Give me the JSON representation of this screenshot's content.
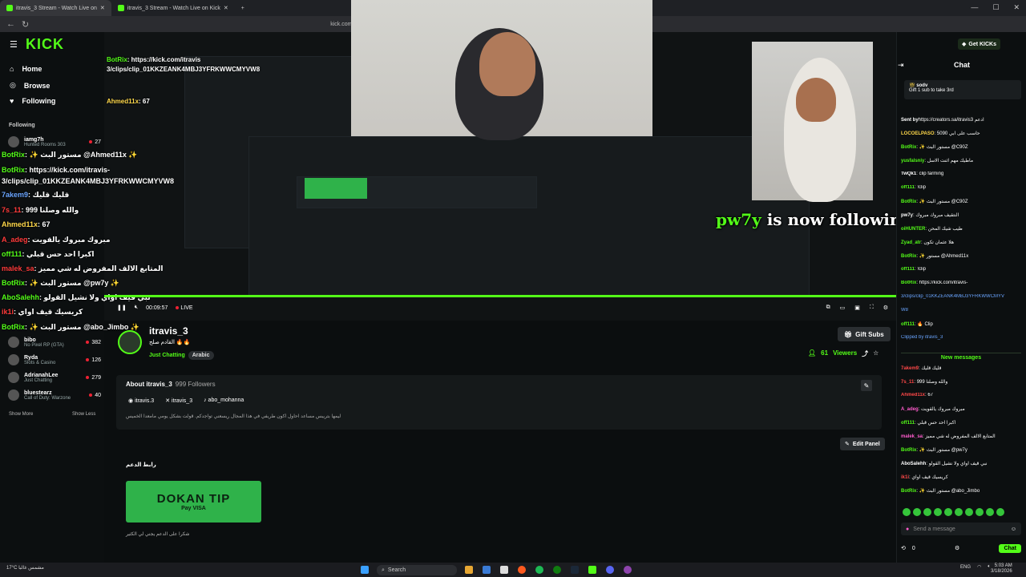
{
  "browser": {
    "tabs": [
      {
        "label": "itravis_3 Stream - Watch Live on"
      },
      {
        "label": "itravis_3 Stream - Watch Live on Kick"
      }
    ],
    "url": "kick.com/itravis"
  },
  "sidebar": {
    "logo": "KICK",
    "nav": [
      {
        "label": "Home"
      },
      {
        "label": "Browse"
      },
      {
        "label": "Following"
      }
    ],
    "following_heading": "Following",
    "following": [
      {
        "name": "iamg7h",
        "game": "Hunted Rooms 303",
        "viewers": "27"
      },
      {
        "name": "bibo",
        "game": "No Pixel RP (GTA)",
        "viewers": "382"
      },
      {
        "name": "Ryda",
        "game": "Slots & Casino",
        "viewers": "126"
      },
      {
        "name": "AdrianahLee",
        "game": "Just Chatting",
        "viewers": "279"
      },
      {
        "name": "bluestearz",
        "game": "Call of Duty: Warzone",
        "viewers": "40"
      }
    ],
    "show_more": "Show More",
    "show_less": "Show Less"
  },
  "overlay_chat": [
    {
      "user": "BotRix",
      "text": ": https://kick.com/itravis"
    },
    {
      "user": "",
      "text": "3/clips/clip_01KKZEANK4MBJ3YFRKWWCMYVW8"
    },
    {
      "user": "Ahmed11x",
      "text": ": 67"
    },
    {
      "user": "BotRix",
      "text": ": ✨ مستور البث @Ahmed11x ✨"
    },
    {
      "user": "BotRix",
      "text": ": https://kick.com/itravis-"
    },
    {
      "user": "",
      "text": "3/clips/clip_01KKZEANK4MBJ3YFRKWWCMYVW8"
    },
    {
      "user": "7akem9",
      "text": ": قليك قليك"
    },
    {
      "user": "7s_11",
      "text": ": 999 والله وصلنا"
    },
    {
      "user": "Ahmed11x",
      "text": ": 67"
    },
    {
      "user": "A_adeg",
      "text": ": مبروك مبروك يالقويت"
    },
    {
      "user": "off111",
      "text": ": اكبرا احد حس قبلي"
    },
    {
      "user": "malek_sa",
      "text": ": المتابع الالف المفروض له شي مميز"
    },
    {
      "user": "BotRix",
      "text": ": ✨ مستور البث @pw7y ✨"
    },
    {
      "user": "AboSalehh",
      "text": ": نبي قيف اواي ولا نشيل القولو"
    },
    {
      "user": "ik1i",
      "text": ": كريسيك قيف اواي"
    },
    {
      "user": "BotRix",
      "text": ": ✨ مستور البث @abo_Jimbo ✨"
    }
  ],
  "stream": {
    "follow_alert_user": "pw7y",
    "follow_alert_text": " is now following!",
    "time": "00:09:57",
    "live": "LIVE"
  },
  "channel": {
    "name": "itravis_3",
    "title": "القادم صلح 🔥🔥",
    "category": "Just Chatting",
    "tag": "Arabic",
    "gift_subs": "Gift Subs",
    "viewers": "61",
    "viewers_label": "Viewers",
    "about_title": "About itravis_3",
    "followers": "999 Followers",
    "socials": [
      {
        "icon": "instagram-icon",
        "label": "itravis.3"
      },
      {
        "icon": "x-icon",
        "label": "itravis_3"
      },
      {
        "icon": "tiktok-icon",
        "label": "abo_mohanna"
      }
    ],
    "bio": "ليمها بتريبس مساعد احاول اكون طريفي في هذا المجال ريسعني تواجدكم. قولت بشكل يومي مامعدا الخميس",
    "edit_panel": "Edit Panel",
    "donate_label": "رابط الدعم",
    "dokan_title": "DOKAN TIP",
    "dokan_pay": "Pay VISA",
    "thanks": "شكرا على الدعم يجني لي الكثير"
  },
  "chat": {
    "get_kicks": "Get KICKs",
    "title": "Chat",
    "pinned_user": "sodv",
    "pinned_text": "Gift 1 sub to take 3rd",
    "messages": [
      {
        "user": "Sent by",
        "text": "https://creators.sa/itravis3 ادعم ",
        "c": "wh"
      },
      {
        "user": "LOCOELPASO",
        "text": ": حاسب على ابي 5090",
        "c": "yl"
      },
      {
        "user": "BotRix",
        "text": ": ✨ مستور البث @C90Z",
        "c": "g"
      },
      {
        "user": "yusfalsniy",
        "text": ": ماطيك مهم اثنت الاسل",
        "c": "g"
      },
      {
        "user": "TwQk1",
        "text": ": clip farming",
        "c": "wh"
      },
      {
        "user": "off111",
        "text": ": !clip",
        "c": "g"
      },
      {
        "user": "BotRix",
        "text": ": ✨ مستور البث @C90Z",
        "c": "g"
      },
      {
        "user": "pw7y",
        "text": ": النتقيف مبروك مبروك",
        "c": "wh"
      },
      {
        "user": "oiHUNTER",
        "text": ": طيب شيك المحن",
        "c": "g"
      },
      {
        "user": "Zyad_atr",
        "text": ": هلا عثمان تكون",
        "c": "g"
      },
      {
        "user": "BotRix",
        "text": ": ✨ مستور @Ahmed11x",
        "c": "g"
      },
      {
        "user": "off111",
        "text": ": !clip",
        "c": "g"
      },
      {
        "user": "BotRix",
        "text": ": https://kick.com/itravis-",
        "c": "g"
      },
      {
        "user": "",
        "text": "3/clips/clip_01KKZEANK4MBJ3YFRKWWCMYV",
        "c": "bl"
      },
      {
        "user": "",
        "text": "W8",
        "c": "bl"
      },
      {
        "user": "off111",
        "text": ": 🔥 Clip",
        "c": "g"
      },
      {
        "user": "",
        "text": "Clipped by itravis_3",
        "c": "wh"
      }
    ],
    "new_messages": "New messages",
    "messages2": [
      {
        "user": "7akem9",
        "text": ": قليك قليك",
        "c": "rd"
      },
      {
        "user": "7s_11",
        "text": ": 999 والله وصلنا",
        "c": "rd"
      },
      {
        "user": "Ahmed11x",
        "text": ": 67",
        "c": "rd"
      },
      {
        "user": "A_adeg",
        "text": ": مبروك مبروك يالقويت",
        "c": "pk"
      },
      {
        "user": "off111",
        "text": ": اكبرا احد حس قبلي",
        "c": "g"
      },
      {
        "user": "malek_sa",
        "text": ": المتابع الالف المفروض له شي مميز",
        "c": "pk"
      },
      {
        "user": "BotRix",
        "text": ": ✨ مستور البث @pw7y",
        "c": "g"
      },
      {
        "user": "AboSalehh",
        "text": ": نبي قيف اواي ولا نشيل القولو",
        "c": "wh"
      },
      {
        "user": "ik1i",
        "text": ": كريسيك قيف اواي",
        "c": "rd"
      },
      {
        "user": "BotRix",
        "text": ": ✨ مستور البث @abo_Jimbo",
        "c": "g"
      }
    ],
    "input_placeholder": "Send a message",
    "points": "0",
    "chat_button": "Chat"
  },
  "taskbar": {
    "weather": "17°C",
    "weather_desc": "مشمس غالبا",
    "search": "Search",
    "lang": "ENG",
    "time": "5:03 AM",
    "date": "3/18/2026"
  },
  "colors": {
    "accent": "#53fc18",
    "bg": "#0b0e0f"
  }
}
